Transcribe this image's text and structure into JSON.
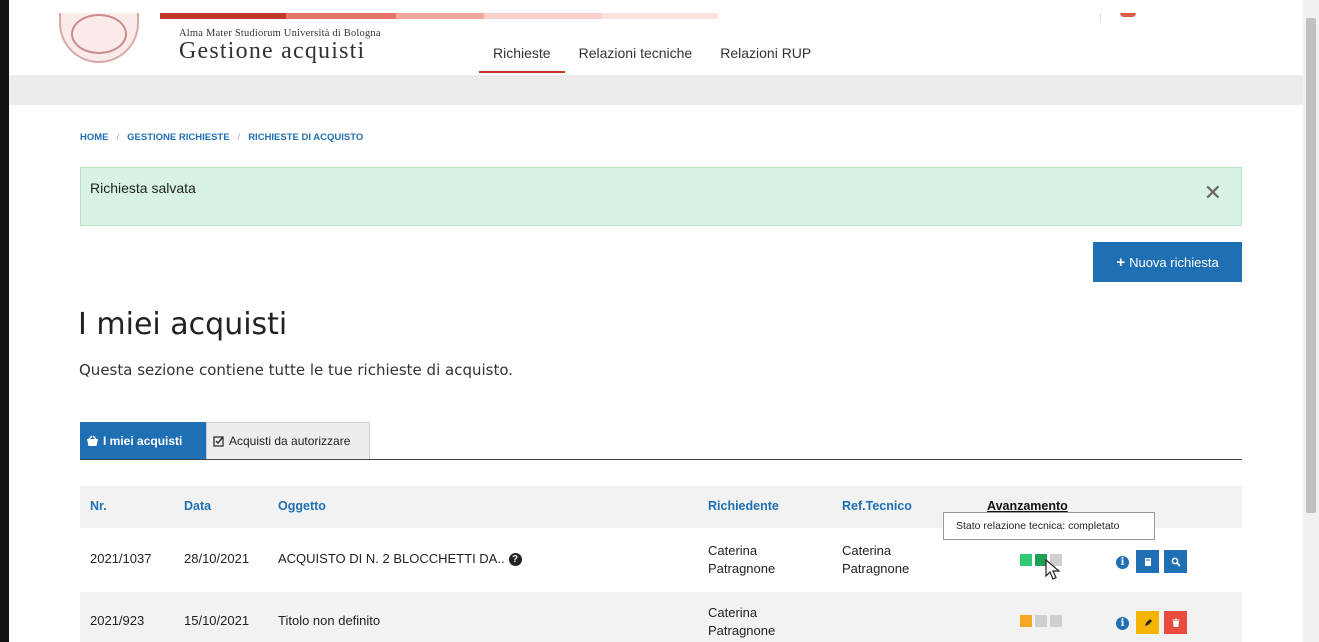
{
  "header": {
    "university": "Alma Mater Studiorum Università di Bologna",
    "app_title": "Gestione acquisti",
    "nav": [
      {
        "label": "Richieste",
        "active": true
      },
      {
        "label": "Relazioni tecniche",
        "active": false
      },
      {
        "label": "Relazioni RUP",
        "active": false
      }
    ]
  },
  "breadcrumb": [
    "HOME",
    "GESTIONE RICHIESTE",
    "RICHIESTE DI ACQUISTO"
  ],
  "alert": {
    "message": "Richiesta salvata",
    "close": "✕"
  },
  "new_request_button": "Nuova richiesta",
  "page": {
    "title": "I miei acquisti",
    "subtitle": "Questa sezione contiene tutte le tue richieste di acquisto."
  },
  "tabs": [
    {
      "label": "I miei acquisti",
      "active": true,
      "icon": "basket-icon"
    },
    {
      "label": "Acquisti da autorizzare",
      "active": false,
      "icon": "checkbox-icon"
    }
  ],
  "table": {
    "headers": [
      "Nr.",
      "Data",
      "Oggetto",
      "Richiedente",
      "Ref.Tecnico",
      "Avanzamento"
    ],
    "rows": [
      {
        "nr": "2021/1037",
        "data": "28/10/2021",
        "oggetto": "ACQUISTO DI N. 2 BLOCCHETTI DA..",
        "richiedente_nome": "Caterina",
        "richiedente_cognome": "Patragnone",
        "ref_nome": "Caterina",
        "ref_cognome": "Patragnone",
        "progress": [
          "#2ecc71",
          "#1fa055",
          "#cfcfcf"
        ],
        "actions": [
          {
            "icon": "book-icon",
            "color": "#1f6fb5"
          },
          {
            "icon": "search-icon",
            "color": "#1f6fb5"
          }
        ]
      },
      {
        "nr": "2021/923",
        "data": "15/10/2021",
        "oggetto": "Titolo non definito",
        "richiedente_nome": "Caterina",
        "richiedente_cognome": "Patragnone",
        "ref_nome": "",
        "ref_cognome": "",
        "progress": [
          "#f5a623",
          "#cfcfcf",
          "#cfcfcf"
        ],
        "actions": [
          {
            "icon": "pencil-icon",
            "color": "#f5b400"
          },
          {
            "icon": "trash-icon",
            "color": "#e74c3c"
          }
        ]
      }
    ]
  },
  "tooltip": "Stato relazione tecnica: completato",
  "colors": {
    "primary": "#1f6fb5",
    "alert_bg": "#d8f3e3",
    "accent_red": "#c0392b"
  }
}
